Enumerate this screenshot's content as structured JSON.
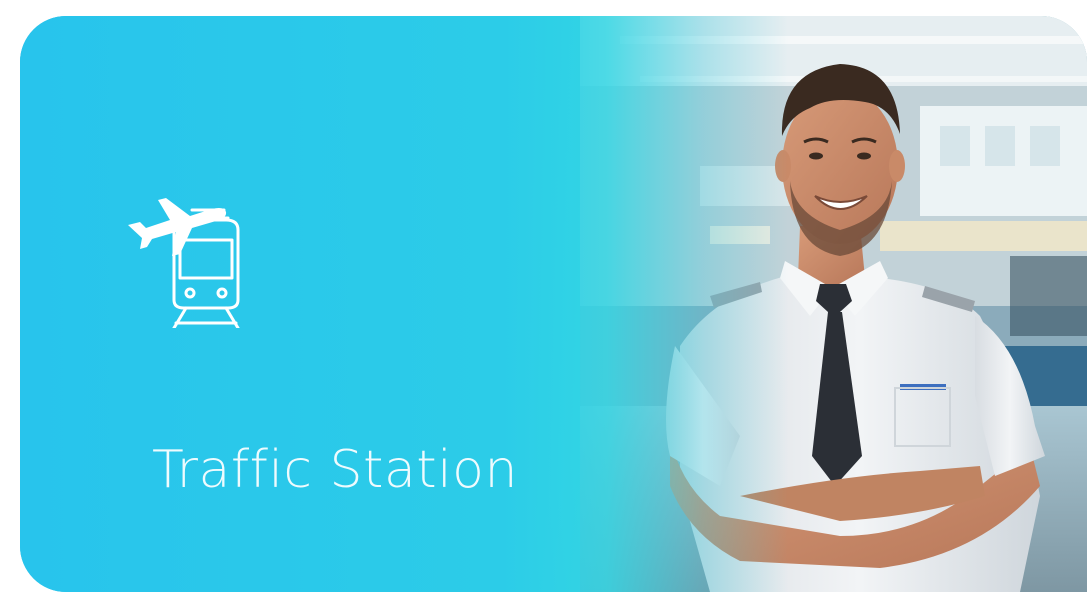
{
  "banner": {
    "title": "Traffic Station",
    "logo_icon": "plane-and-train-icon",
    "photo": "smiling-pilot-in-airport-terminal"
  },
  "colors": {
    "gradient_start": "#25b6ea",
    "gradient_mid": "#31d6e2",
    "text": "#ffffff",
    "tie": "#2b2f36",
    "shirt": "#eef1f3"
  }
}
